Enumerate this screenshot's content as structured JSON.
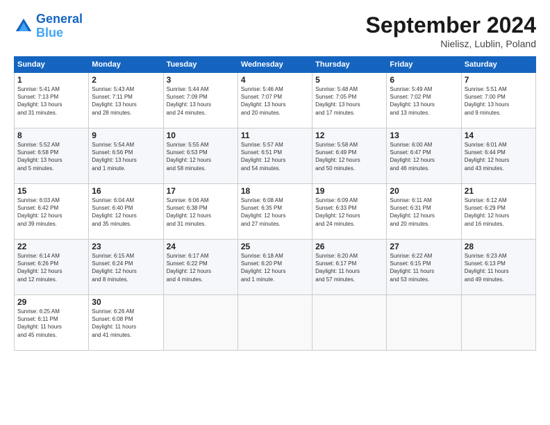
{
  "header": {
    "logo_line1": "General",
    "logo_line2": "Blue",
    "month_title": "September 2024",
    "location": "Nielisz, Lublin, Poland"
  },
  "days_of_week": [
    "Sunday",
    "Monday",
    "Tuesday",
    "Wednesday",
    "Thursday",
    "Friday",
    "Saturday"
  ],
  "weeks": [
    [
      {
        "day": "1",
        "info": "Sunrise: 5:41 AM\nSunset: 7:13 PM\nDaylight: 13 hours\nand 31 minutes."
      },
      {
        "day": "2",
        "info": "Sunrise: 5:43 AM\nSunset: 7:11 PM\nDaylight: 13 hours\nand 28 minutes."
      },
      {
        "day": "3",
        "info": "Sunrise: 5:44 AM\nSunset: 7:09 PM\nDaylight: 13 hours\nand 24 minutes."
      },
      {
        "day": "4",
        "info": "Sunrise: 5:46 AM\nSunset: 7:07 PM\nDaylight: 13 hours\nand 20 minutes."
      },
      {
        "day": "5",
        "info": "Sunrise: 5:48 AM\nSunset: 7:05 PM\nDaylight: 13 hours\nand 17 minutes."
      },
      {
        "day": "6",
        "info": "Sunrise: 5:49 AM\nSunset: 7:02 PM\nDaylight: 13 hours\nand 13 minutes."
      },
      {
        "day": "7",
        "info": "Sunrise: 5:51 AM\nSunset: 7:00 PM\nDaylight: 13 hours\nand 9 minutes."
      }
    ],
    [
      {
        "day": "8",
        "info": "Sunrise: 5:52 AM\nSunset: 6:58 PM\nDaylight: 13 hours\nand 5 minutes."
      },
      {
        "day": "9",
        "info": "Sunrise: 5:54 AM\nSunset: 6:56 PM\nDaylight: 13 hours\nand 1 minute."
      },
      {
        "day": "10",
        "info": "Sunrise: 5:55 AM\nSunset: 6:53 PM\nDaylight: 12 hours\nand 58 minutes."
      },
      {
        "day": "11",
        "info": "Sunrise: 5:57 AM\nSunset: 6:51 PM\nDaylight: 12 hours\nand 54 minutes."
      },
      {
        "day": "12",
        "info": "Sunrise: 5:58 AM\nSunset: 6:49 PM\nDaylight: 12 hours\nand 50 minutes."
      },
      {
        "day": "13",
        "info": "Sunrise: 6:00 AM\nSunset: 6:47 PM\nDaylight: 12 hours\nand 46 minutes."
      },
      {
        "day": "14",
        "info": "Sunrise: 6:01 AM\nSunset: 6:44 PM\nDaylight: 12 hours\nand 43 minutes."
      }
    ],
    [
      {
        "day": "15",
        "info": "Sunrise: 6:03 AM\nSunset: 6:42 PM\nDaylight: 12 hours\nand 39 minutes."
      },
      {
        "day": "16",
        "info": "Sunrise: 6:04 AM\nSunset: 6:40 PM\nDaylight: 12 hours\nand 35 minutes."
      },
      {
        "day": "17",
        "info": "Sunrise: 6:06 AM\nSunset: 6:38 PM\nDaylight: 12 hours\nand 31 minutes."
      },
      {
        "day": "18",
        "info": "Sunrise: 6:08 AM\nSunset: 6:35 PM\nDaylight: 12 hours\nand 27 minutes."
      },
      {
        "day": "19",
        "info": "Sunrise: 6:09 AM\nSunset: 6:33 PM\nDaylight: 12 hours\nand 24 minutes."
      },
      {
        "day": "20",
        "info": "Sunrise: 6:11 AM\nSunset: 6:31 PM\nDaylight: 12 hours\nand 20 minutes."
      },
      {
        "day": "21",
        "info": "Sunrise: 6:12 AM\nSunset: 6:29 PM\nDaylight: 12 hours\nand 16 minutes."
      }
    ],
    [
      {
        "day": "22",
        "info": "Sunrise: 6:14 AM\nSunset: 6:26 PM\nDaylight: 12 hours\nand 12 minutes."
      },
      {
        "day": "23",
        "info": "Sunrise: 6:15 AM\nSunset: 6:24 PM\nDaylight: 12 hours\nand 8 minutes."
      },
      {
        "day": "24",
        "info": "Sunrise: 6:17 AM\nSunset: 6:22 PM\nDaylight: 12 hours\nand 4 minutes."
      },
      {
        "day": "25",
        "info": "Sunrise: 6:18 AM\nSunset: 6:20 PM\nDaylight: 12 hours\nand 1 minute."
      },
      {
        "day": "26",
        "info": "Sunrise: 6:20 AM\nSunset: 6:17 PM\nDaylight: 11 hours\nand 57 minutes."
      },
      {
        "day": "27",
        "info": "Sunrise: 6:22 AM\nSunset: 6:15 PM\nDaylight: 11 hours\nand 53 minutes."
      },
      {
        "day": "28",
        "info": "Sunrise: 6:23 AM\nSunset: 6:13 PM\nDaylight: 11 hours\nand 49 minutes."
      }
    ],
    [
      {
        "day": "29",
        "info": "Sunrise: 6:25 AM\nSunset: 6:11 PM\nDaylight: 11 hours\nand 45 minutes."
      },
      {
        "day": "30",
        "info": "Sunrise: 6:26 AM\nSunset: 6:08 PM\nDaylight: 11 hours\nand 41 minutes."
      },
      {
        "day": "",
        "info": ""
      },
      {
        "day": "",
        "info": ""
      },
      {
        "day": "",
        "info": ""
      },
      {
        "day": "",
        "info": ""
      },
      {
        "day": "",
        "info": ""
      }
    ]
  ]
}
